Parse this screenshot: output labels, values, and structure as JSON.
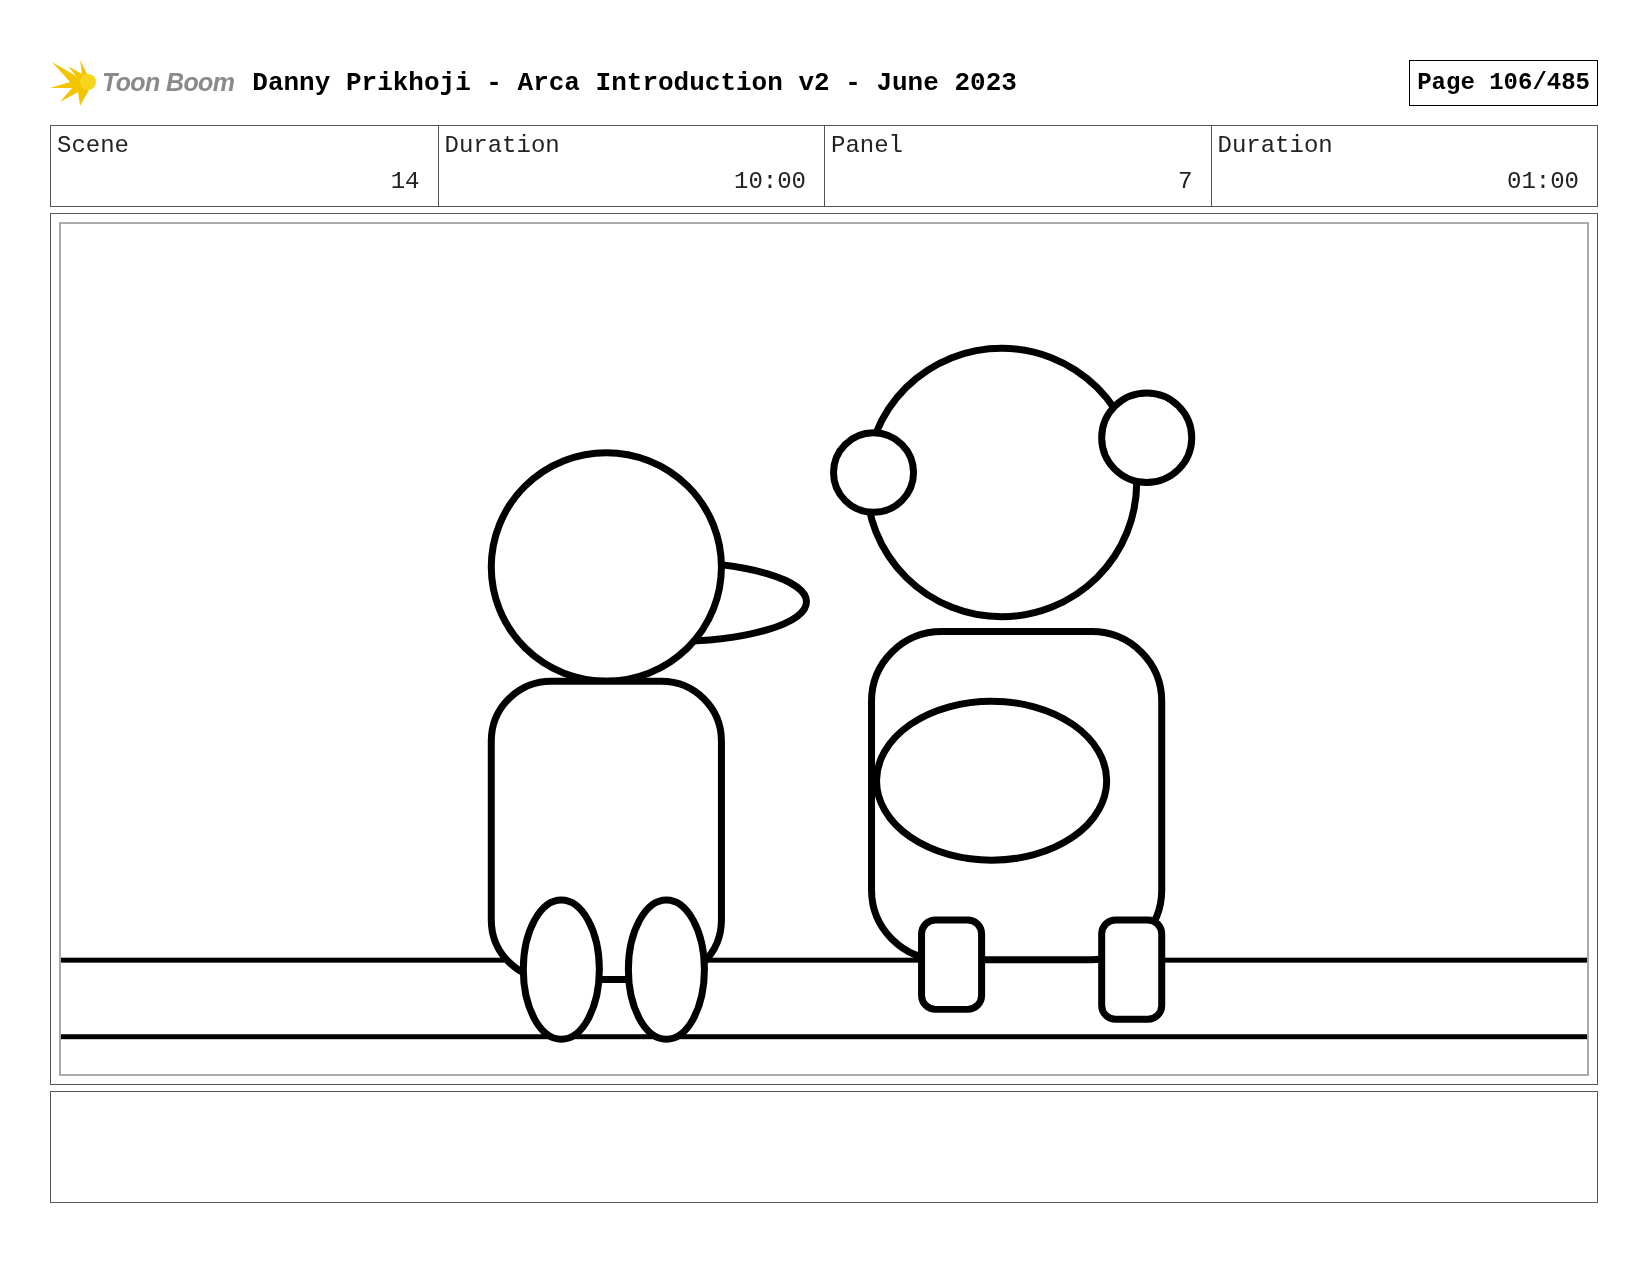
{
  "header": {
    "logo_text": "Toon Boom",
    "title": "Danny Prikhoji - Arca Introduction v2 - June 2023",
    "page": "Page 106/485"
  },
  "info": [
    {
      "label": "Scene",
      "value": "14"
    },
    {
      "label": "Duration",
      "value": "10:00"
    },
    {
      "label": "Panel",
      "value": "7"
    },
    {
      "label": "Duration",
      "value": "01:00"
    }
  ]
}
